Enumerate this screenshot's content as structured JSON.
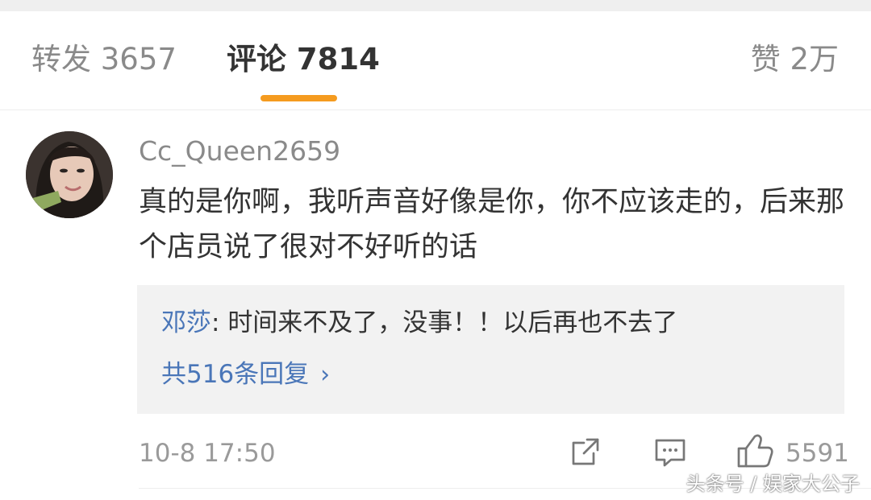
{
  "tabs": {
    "repost_label": "转发 3657",
    "comments_label": "评论 7814",
    "likes_label": "赞 2万"
  },
  "comment": {
    "username": "Cc_Queen2659",
    "text": "真的是你啊，我听声音好像是你，你不应该走的，后来那个店员说了很对不好听的话",
    "timestamp": "10-8 17:50",
    "like_count": "5591",
    "reply": {
      "author": "邓莎",
      "separator": ": ",
      "text": "时间来不及了，没事！！以后再也不去了",
      "count_label": "共516条回复",
      "chevron": "›"
    }
  },
  "icons": {
    "share": "share-icon",
    "comment": "comment-icon",
    "like": "thumbs-up-icon"
  },
  "watermark": "头条号 / 娱家大公子",
  "colors": {
    "active_indicator": "#f59b1f",
    "link": "#4a76b8",
    "primary_text": "#333333",
    "secondary_text": "#8a8a8a"
  }
}
